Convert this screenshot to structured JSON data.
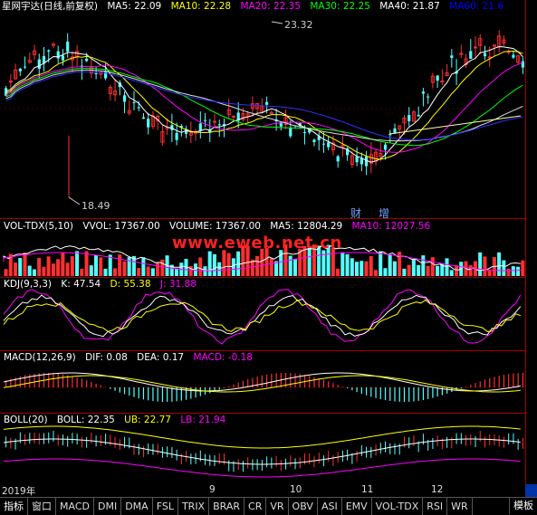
{
  "main": {
    "title": "星网宇达(日线,前复权)",
    "ma": [
      {
        "label": "MA5: 22.09",
        "color": "#ffffff"
      },
      {
        "label": "MA10: 22.28",
        "color": "#ffff00"
      },
      {
        "label": "MA20: 22.35",
        "color": "#ff00ff"
      },
      {
        "label": "MA30: 22.25",
        "color": "#00ff00"
      },
      {
        "label": "MA40: 21.87",
        "color": "#ffffff"
      },
      {
        "label": "MA60: 21.6",
        "color": "#0000ff"
      }
    ],
    "high_label": "23.32",
    "low_label": "18.49",
    "markers": [
      "财",
      "增"
    ]
  },
  "volume": {
    "title": "VOL-TDX(5,10)",
    "vvol": "VVOL: 17367.00",
    "volume": "VOLUME: 17367.00",
    "ma5": "MA5: 12804.29",
    "ma10": "MA10: 12027.56"
  },
  "kdj": {
    "title": "KDJ(9,3,3)",
    "k": "K: 47.54",
    "d": "D: 55.38",
    "j": "J: 31.88"
  },
  "macd": {
    "title": "MACD(12,26,9)",
    "dif": "DIF: 0.08",
    "dea": "DEA: 0.17",
    "macd": "MACD: -0.18"
  },
  "boll": {
    "title": "BOLL(20)",
    "boll": "BOLL: 22.35",
    "ub": "UB: 22.77",
    "lb": "LB: 21.94"
  },
  "dates": [
    "2019年",
    "9",
    "10",
    "11",
    "12"
  ],
  "watermark": "www.eweb.net.cn",
  "tabs": [
    "指标",
    "窗口",
    "MACD",
    "DMI",
    "DMA",
    "FSL",
    "TRIX",
    "BRAR",
    "CR",
    "VR",
    "OBV",
    "ASI",
    "EMV",
    "VOL-TDX",
    "RSI",
    "WR"
  ],
  "template_button": "模板",
  "colors": {
    "up": "#ff3030",
    "down": "#54ffff",
    "grid": "#a00000"
  }
}
